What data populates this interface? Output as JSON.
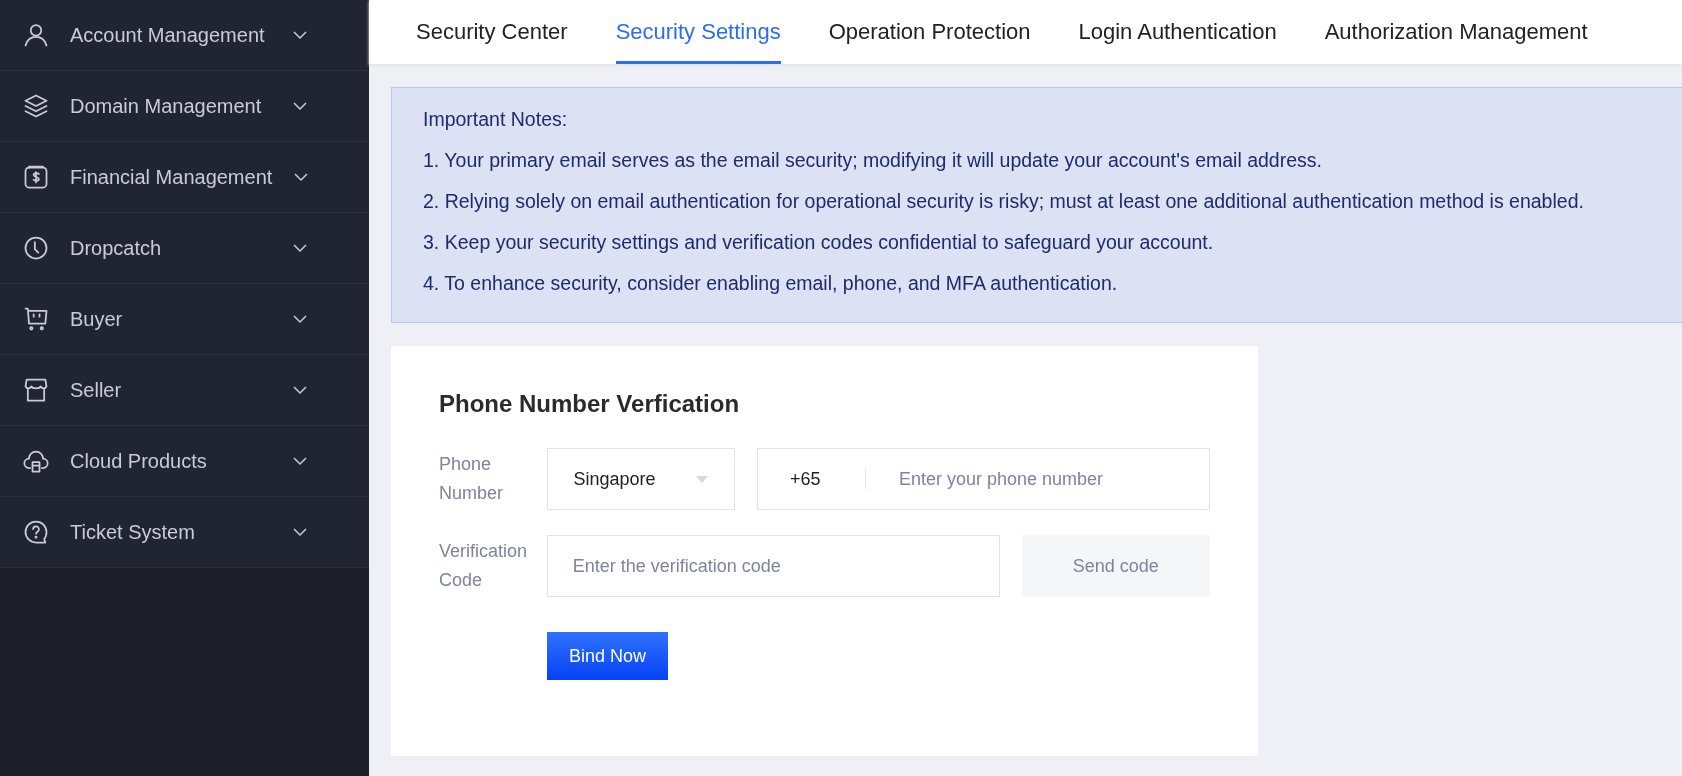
{
  "sidebar": {
    "items": [
      {
        "label": "Account Management",
        "expanded": false
      },
      {
        "label": "Domain Management",
        "expanded": false
      },
      {
        "label": "Financial Management",
        "expanded": false
      },
      {
        "label": "Dropcatch",
        "expanded": false
      },
      {
        "label": "Buyer",
        "expanded": false
      },
      {
        "label": "Seller",
        "expanded": false
      },
      {
        "label": "Cloud Products",
        "expanded": false
      },
      {
        "label": "Ticket System",
        "expanded": false
      }
    ]
  },
  "tabs": [
    {
      "label": "Security Center",
      "selected": false
    },
    {
      "label": "Security Settings",
      "selected": true
    },
    {
      "label": "Operation Protection",
      "selected": false
    },
    {
      "label": "Login Authentication",
      "selected": false
    },
    {
      "label": "Authorization Management",
      "selected": false
    }
  ],
  "notes": {
    "title": "Important Notes:",
    "lines": [
      "1. Your primary email serves as the email security; modifying it will update your account's email address.",
      "2. Relying solely on email authentication for operational security is risky; must at least one additional authentication method is enabled.",
      "3. Keep your security settings and verification codes confidential to safeguard your account.",
      "4. To enhance security, consider enabling email, phone, and MFA authentication."
    ]
  },
  "form": {
    "title": "Phone Number Verfication",
    "phone": {
      "label": "Phone\nNumber",
      "country": "Singapore",
      "code": "+65",
      "placeholder": "Enter your phone number"
    },
    "verification": {
      "label": "Verification\nCode",
      "placeholder": "Enter the verification code",
      "send_button": "Send code"
    },
    "submit": "Bind Now"
  }
}
